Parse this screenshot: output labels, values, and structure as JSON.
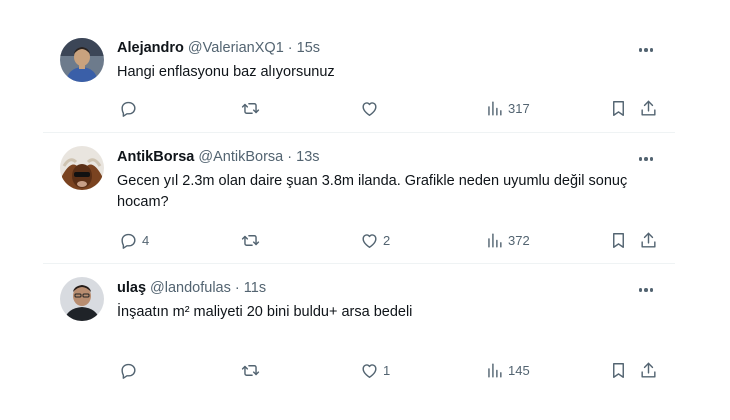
{
  "tweets": [
    {
      "name": "Alejandro",
      "handle": "@ValerianXQ1",
      "sep": "·",
      "time": "15s",
      "text": "Hangi enflasyonu baz alıyorsunuz",
      "replies": "",
      "retweets": "",
      "likes": "",
      "views": "317"
    },
    {
      "name": "AntikBorsa",
      "handle": "@AntikBorsa",
      "sep": "·",
      "time": "13s",
      "text": "Gecen yıl 2.3m olan daire şuan 3.8m ilanda. Grafikle neden uyumlu değil sonuç hocam?",
      "replies": "4",
      "retweets": "",
      "likes": "2",
      "views": "372"
    },
    {
      "name": "ulaş",
      "handle": "@landofulas",
      "sep": "·",
      "time": "11s",
      "text": "İnşaatın m² maliyeti 20 bini buldu+ arsa bedeli",
      "replies": "",
      "retweets": "",
      "likes": "1",
      "views": "145"
    }
  ],
  "icons": {
    "reply": "reply-icon",
    "retweet": "retweet-icon",
    "like": "like-icon",
    "views": "views-icon",
    "bookmark": "bookmark-icon",
    "share": "share-icon",
    "more": "more-icon"
  },
  "colors": {
    "text": "#0f1419",
    "muted": "#536471",
    "divider": "#eff3f4"
  }
}
